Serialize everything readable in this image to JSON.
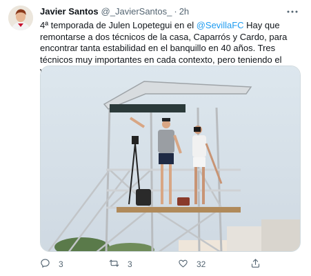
{
  "author": {
    "name": "Javier Santos",
    "handle": "@_JavierSantos_",
    "separator": "·",
    "time": "2h"
  },
  "tweet": {
    "text_before": "4ª temporada de Julen Lopetegui en el ",
    "mention": "@SevillaFC",
    "text_after": " Hay que remontarse a dos técnicos de la casa, Caparrós y Cardo, para encontrar tanta estabilidad en el banquillo en 40 años. Tres técnicos muy importantes en cada contexto, pero teniendo el vasco números y logros imbatibles"
  },
  "actions": {
    "reply_count": "3",
    "retweet_count": "3",
    "like_count": "32"
  },
  "icons": {
    "more": "more-dots-icon",
    "reply": "reply-icon",
    "retweet": "retweet-icon",
    "like": "heart-icon",
    "share": "share-icon"
  },
  "colors": {
    "link": "#1d9bf0",
    "secondary": "#536471",
    "text": "#0f1419"
  }
}
